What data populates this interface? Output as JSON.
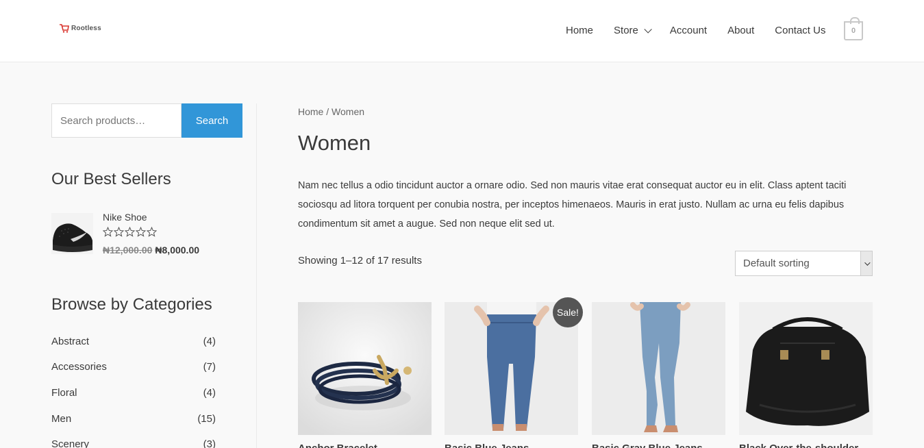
{
  "header": {
    "logo_text": "Rootless",
    "nav": [
      {
        "label": "Home"
      },
      {
        "label": "Store"
      },
      {
        "label": "Account"
      },
      {
        "label": "About"
      },
      {
        "label": "Contact Us"
      }
    ],
    "cart_count": "0"
  },
  "sidebar": {
    "search_placeholder": "Search products…",
    "search_button": "Search",
    "best_sellers_title": "Our Best Sellers",
    "best_seller": {
      "name": "Nike Shoe",
      "rating": 0,
      "old_price": "₦12,000.00",
      "new_price": "₦8,000.00"
    },
    "categories_title": "Browse by Categories",
    "categories": [
      {
        "name": "Abstract",
        "count": "(4)"
      },
      {
        "name": "Accessories",
        "count": "(7)"
      },
      {
        "name": "Floral",
        "count": "(4)"
      },
      {
        "name": "Men",
        "count": "(15)"
      },
      {
        "name": "Scenery",
        "count": "(3)"
      }
    ]
  },
  "main": {
    "breadcrumb_home": "Home",
    "breadcrumb_sep": " / ",
    "breadcrumb_current": "Women",
    "title": "Women",
    "description": "Nam nec tellus a odio tincidunt auctor a ornare odio. Sed non mauris vitae erat consequat auctor eu in elit. Class aptent taciti sociosqu ad litora torquent per conubia nostra, per inceptos himenaeos. Mauris in erat justo. Nullam ac urna eu felis dapibus condimentum sit amet a augue. Sed non neque elit sed ut.",
    "results": "Showing 1–12 of 17 results",
    "sort_selected": "Default sorting",
    "sale_badge": "Sale!",
    "products": [
      {
        "title": "Anchor Bracelet"
      },
      {
        "title": "Basic Blue Jeans"
      },
      {
        "title": "Basic Gray Blue Jeans"
      },
      {
        "title": "Black Over-the-shoulder"
      }
    ]
  }
}
